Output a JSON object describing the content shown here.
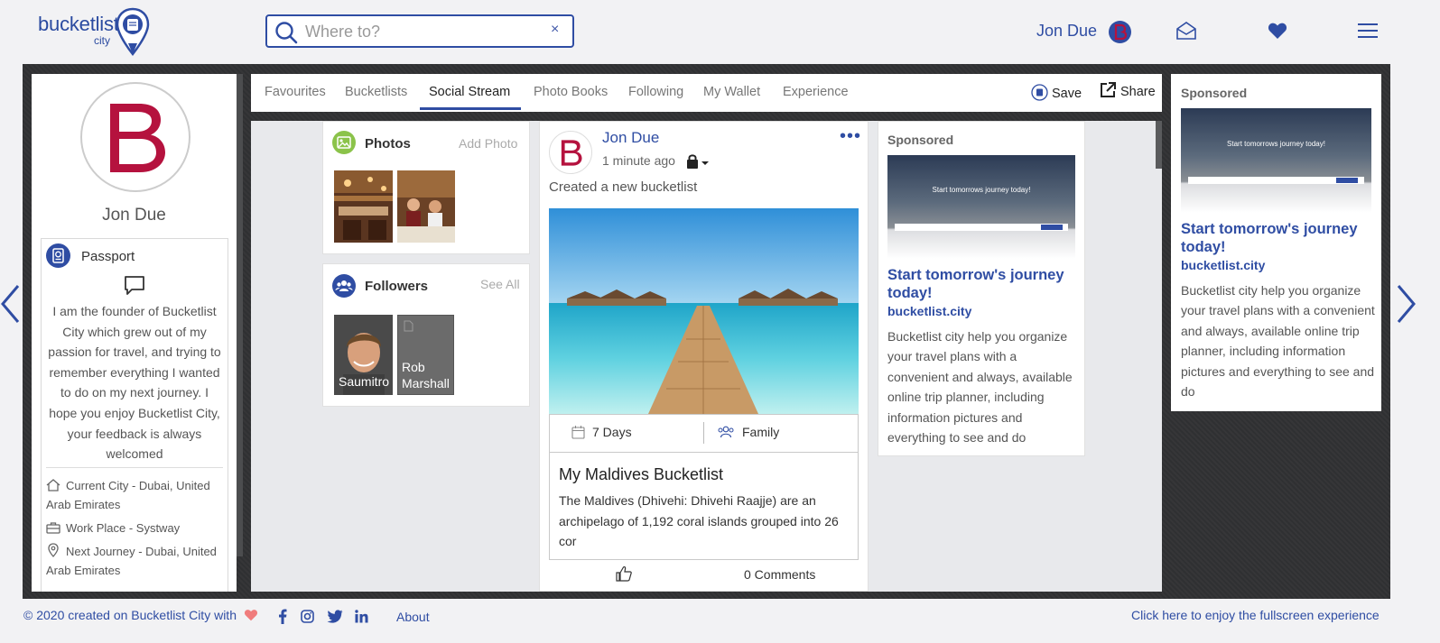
{
  "header": {
    "logo_text": "bucketlist",
    "logo_sub": "city",
    "search_placeholder": "Where to?",
    "clear_glyph": "×",
    "user_name": "Jon Due",
    "brand_color": "#2f4da3",
    "avatar_color": "#b5123e"
  },
  "profile": {
    "name": "Jon Due",
    "passport_label": "Passport",
    "bio": "I am the founder of Bucketlist City which grew out of my passion for travel, and trying to remember everything I wanted to do on my next journey. I hope you enjoy Bucketlist City, your feedback is always welcomed",
    "current_city": "Current City - Dubai, United Arab Emirates",
    "work_place": "Work Place - Systway",
    "next_journey": "Next Journey - Dubai, United Arab Emirates"
  },
  "tabs": [
    {
      "label": "Favourites"
    },
    {
      "label": "Bucketlists"
    },
    {
      "label": "Social Stream",
      "active": true
    },
    {
      "label": "Photo Books"
    },
    {
      "label": "Following"
    },
    {
      "label": "My Wallet"
    },
    {
      "label": "Experience"
    }
  ],
  "toolbar": {
    "save_label": "Save",
    "share_label": "Share"
  },
  "photos": {
    "title": "Photos",
    "action": "Add Photo"
  },
  "followers": {
    "title": "Followers",
    "action": "See All",
    "items": [
      {
        "name": "Saumitro"
      },
      {
        "name": "Rob Marshall"
      }
    ]
  },
  "post": {
    "user": "Jon Due",
    "time": "1 minute ago",
    "more": "•••",
    "caption": "Created a new bucketlist",
    "duration": "7 Days",
    "group": "Family",
    "title": "My Maldives Bucketlist",
    "description": "The Maldives (Dhivehi: Dhivehi Raajje) are an archipelago of 1,192 coral islands grouped into 26 cor",
    "comments": "0 Comments"
  },
  "sponsored": {
    "label": "Sponsored",
    "banner_text": "Start tomorrows journey today!",
    "title": "Start tomorrow's journey today!",
    "link": "bucketlist.city",
    "description": "Bucketlist city help you organize your travel plans with a convenient and always, available online trip planner, including information pictures and everything to see and do"
  },
  "footer": {
    "copyright": "© 2020 created on Bucketlist City with",
    "about": "About",
    "fullscreen": "Click here to enjoy the fullscreen experience"
  }
}
